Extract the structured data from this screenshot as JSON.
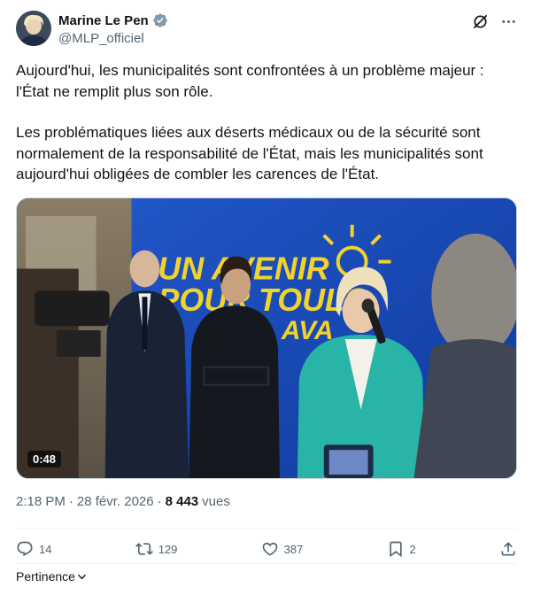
{
  "author": {
    "name": "Marine Le Pen",
    "handle": "@MLP_officiel",
    "verified": true
  },
  "header": {
    "icons": [
      "grok-icon",
      "more-icon"
    ]
  },
  "tweet": {
    "paragraphs": [
      "Aujourd'hui, les municipalités sont confrontées à un problème majeur : l'État ne remplit plus son rôle.",
      "Les problématiques liées aux déserts médicaux ou de la sécurité sont normalement de la responsabilité de l'État, mais les municipalités sont aujourd'hui obligées de combler les carences de l'État."
    ]
  },
  "media": {
    "duration": "0:48",
    "banner_line1": "UN AVENIR",
    "banner_line2": "POUR TOULO",
    "banner_line3": "AVA"
  },
  "meta": {
    "time": "2:18 PM",
    "separator": "·",
    "date": "28 févr. 2026",
    "views_count": "8 443",
    "views_label": "vues"
  },
  "actions": {
    "replies": "14",
    "reposts": "129",
    "likes": "387",
    "bookmarks": "2"
  },
  "footer": {
    "relevance_label": "Pertinence"
  },
  "colors": {
    "text": "#0f1419",
    "secondary": "#536471",
    "verified": "#829aab",
    "divider": "#eff3f4"
  }
}
